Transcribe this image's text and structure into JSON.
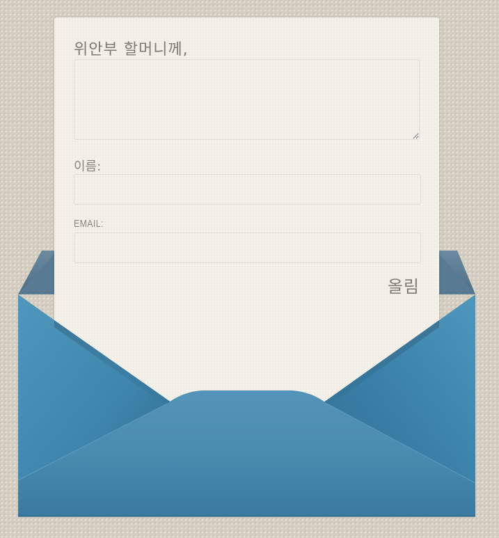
{
  "form": {
    "salutation": "위안부 할머니께,",
    "message_value": "",
    "name_label": "이름:",
    "name_value": "",
    "email_label": "EMAIL:",
    "email_value": "",
    "submit_label": "올림"
  },
  "colors": {
    "background": "#d4cdc0",
    "paper": "#f4f0ea",
    "text": "#7f7a74",
    "field_border": "#e1dcd4",
    "envelope_blue": "#3f86ad",
    "envelope_blue_dark": "#2f6a8f",
    "envelope_lining": "#5a7d96"
  },
  "icons": [
    "envelope-icon"
  ]
}
